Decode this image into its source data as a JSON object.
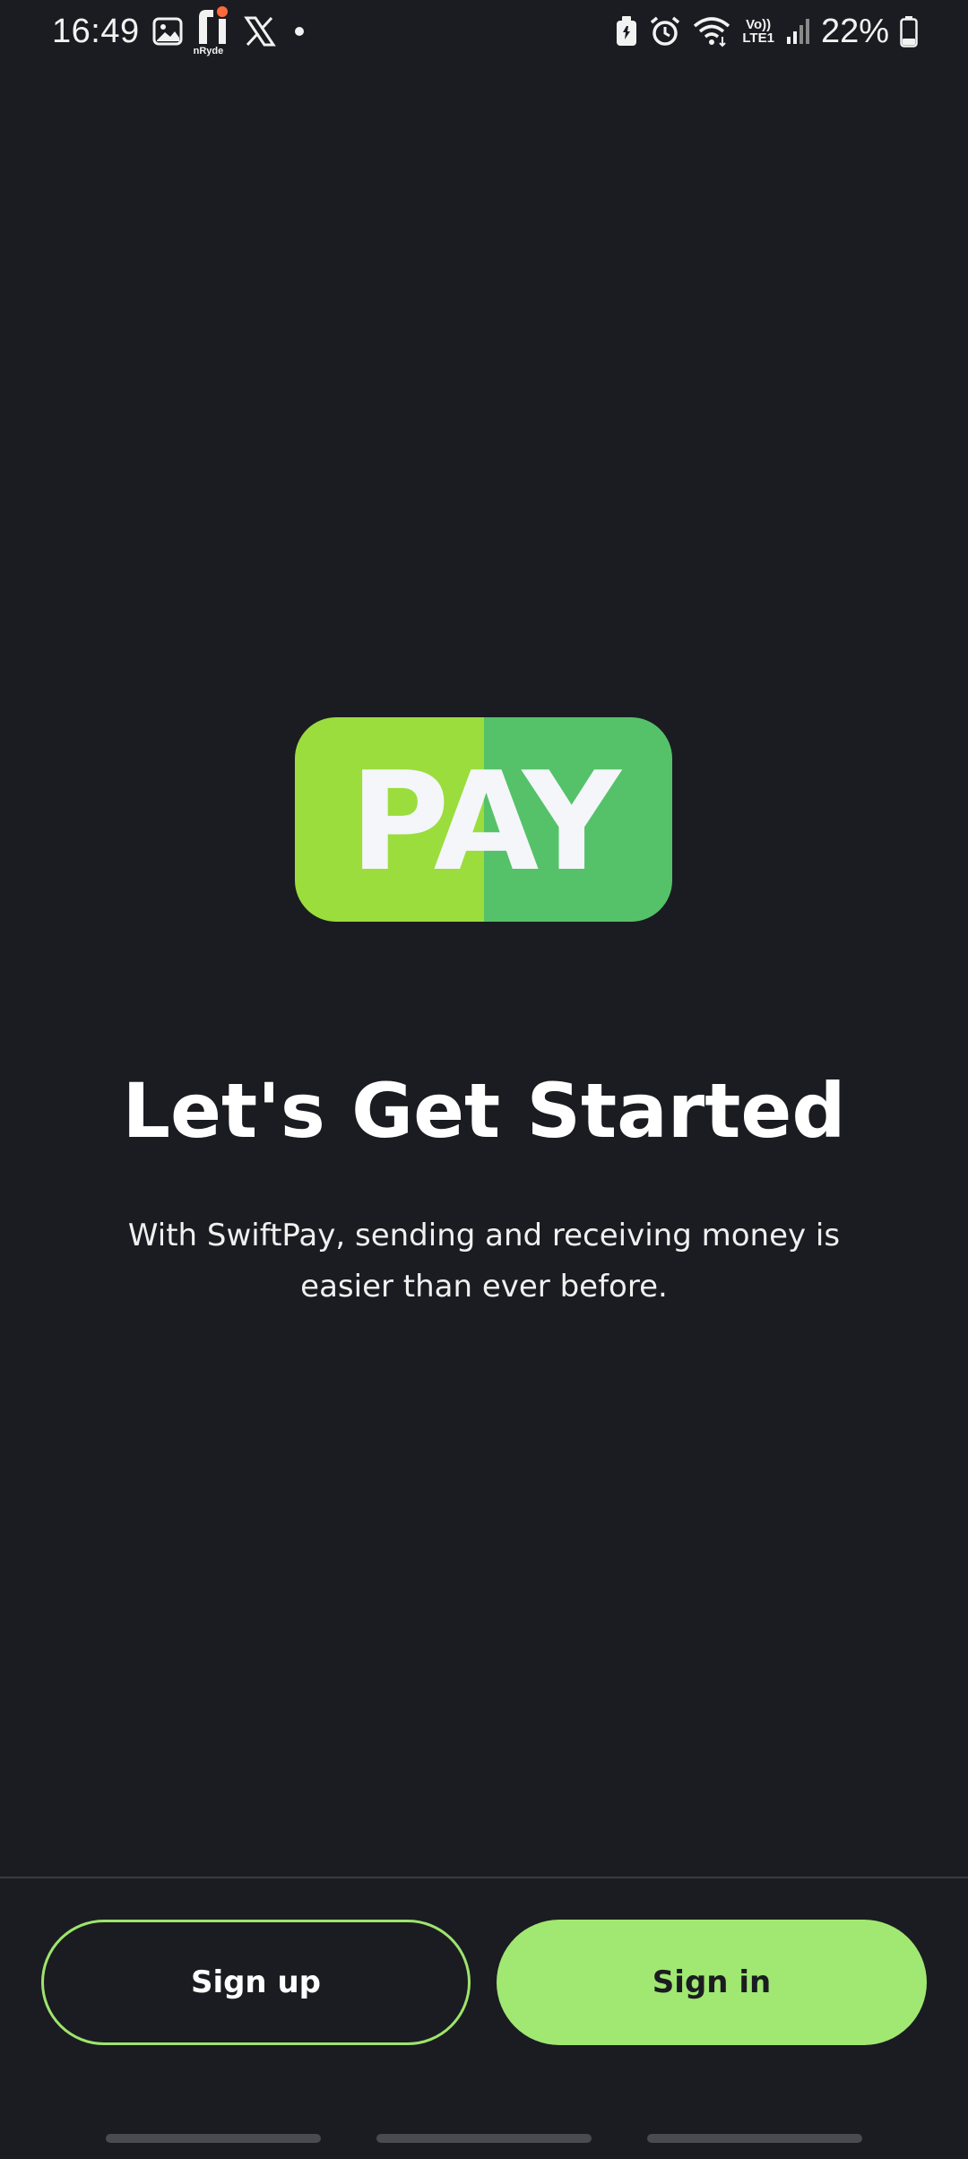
{
  "status_bar": {
    "time": "16:49",
    "notification_icons": [
      "gallery-icon",
      "nryde-icon",
      "x-icon",
      "dot-icon"
    ],
    "nryde_label": "nRyde",
    "system_icons": [
      "battery-saver-icon",
      "alarm-icon",
      "wifi-icon",
      "volte-icon",
      "signal-icon",
      "battery-icon"
    ],
    "volte_label_top": "Vo))",
    "volte_label_bottom": "LTE1",
    "battery_percent": "22%"
  },
  "logo": {
    "text": "PAY",
    "color_left": "#9bdd3d",
    "color_right": "#55c26a"
  },
  "main": {
    "headline": "Let's Get Started",
    "subtext": "With SwiftPay, sending and receiving money is easier than ever before."
  },
  "actions": {
    "sign_up_label": "Sign up",
    "sign_in_label": "Sign in",
    "accent_color": "#a0e872"
  },
  "colors": {
    "background": "#1b1c21"
  }
}
